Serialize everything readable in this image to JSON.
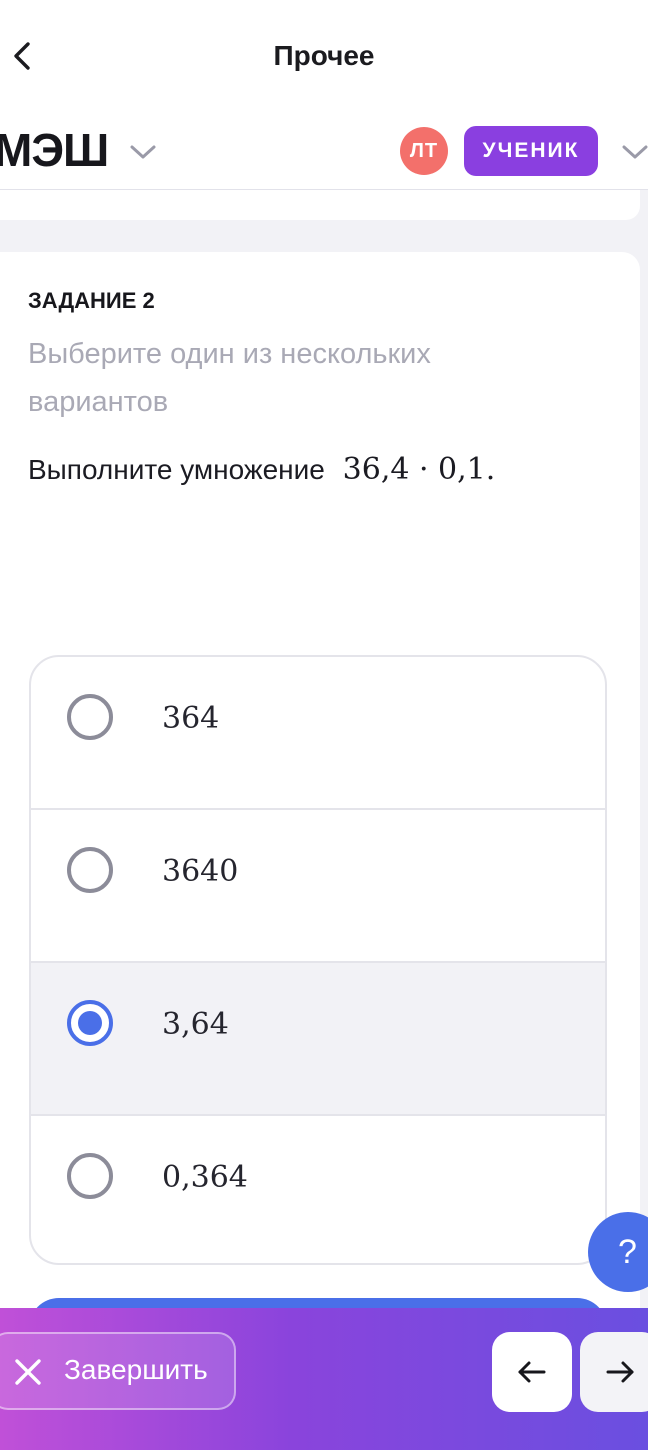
{
  "header": {
    "title": "Прочее",
    "logo_text": "МЭШ",
    "avatar_initials": "ЛТ",
    "role_label": "УЧЕНИК",
    "icons": [
      "chevron-left-icon",
      "chevron-down-icon"
    ]
  },
  "task": {
    "number_label": "ЗАДАНИЕ 2",
    "hint": "Выберите один из нескольких вариантов",
    "question_text": "Выполните умножение",
    "question_math": "36,4 · 0,1."
  },
  "options": [
    {
      "label": "364",
      "selected": false
    },
    {
      "label": "3640",
      "selected": false
    },
    {
      "label": "3,64",
      "selected": true
    },
    {
      "label": "0,364",
      "selected": false
    }
  ],
  "help": {
    "label": "?"
  },
  "footer": {
    "finish_label": "Завершить",
    "icons": [
      "close-icon",
      "arrow-left-icon",
      "arrow-right-icon"
    ]
  },
  "colors": {
    "accent": "#4a6fe8",
    "role_badge": "#8a3fe0",
    "avatar": "#f3706b"
  }
}
